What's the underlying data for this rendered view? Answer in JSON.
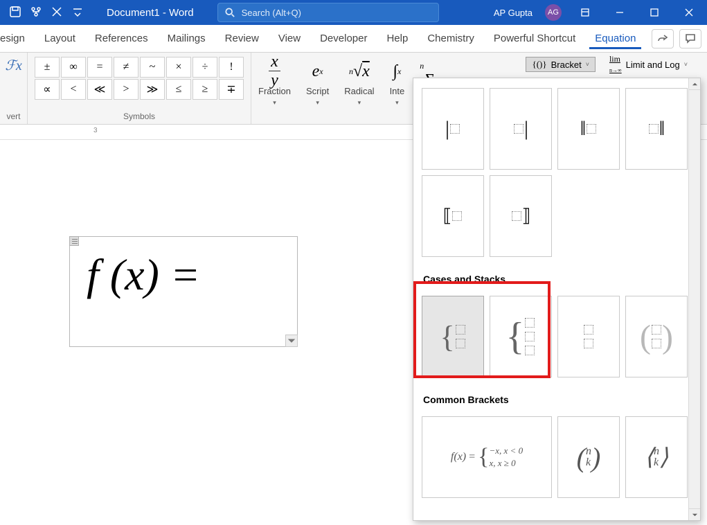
{
  "titlebar": {
    "doc_title": "Document1 - Word",
    "search_placeholder": "Search (Alt+Q)",
    "user_name": "AP Gupta",
    "user_initials": "AG"
  },
  "tabs": {
    "items": [
      "esign",
      "Layout",
      "References",
      "Mailings",
      "Review",
      "View",
      "Developer",
      "Help",
      "Chemistry",
      "Powerful Shortcut",
      "Equation"
    ],
    "active_index": 10
  },
  "ribbon": {
    "convert_label": "vert",
    "symbols_label": "Symbols",
    "symbols": [
      "±",
      "∞",
      "=",
      "≠",
      "~",
      "×",
      "÷",
      "!",
      "∝",
      "<",
      "≪",
      ">",
      "≫",
      "≤",
      "≥",
      "∓"
    ],
    "structures": [
      {
        "glyph_html": "x/y",
        "label": "Fraction"
      },
      {
        "glyph_html": "eˣ",
        "label": "Script"
      },
      {
        "glyph_html": "ⁿ√x",
        "label": "Radical"
      },
      {
        "glyph_html": "∫ˣ",
        "label": "Inte"
      },
      {
        "glyph_html": "Σ",
        "label": ""
      }
    ],
    "menus": {
      "bracket_glyph": "{()}",
      "bracket_label": "Bracket",
      "limit_glyph": "lim",
      "limit_label": "Limit and Log"
    }
  },
  "ruler": {
    "mark_3": "3"
  },
  "equation": {
    "text": "f (x)  ="
  },
  "dropdown": {
    "section2_title": "Cases and Stacks",
    "section3_title": "Common Brackets",
    "common1_line1": "−x,     x < 0",
    "common1_line2": "x,     x ≥ 0",
    "common1_prefix": "f(x) = {",
    "binom_n": "n",
    "binom_k": "k"
  }
}
